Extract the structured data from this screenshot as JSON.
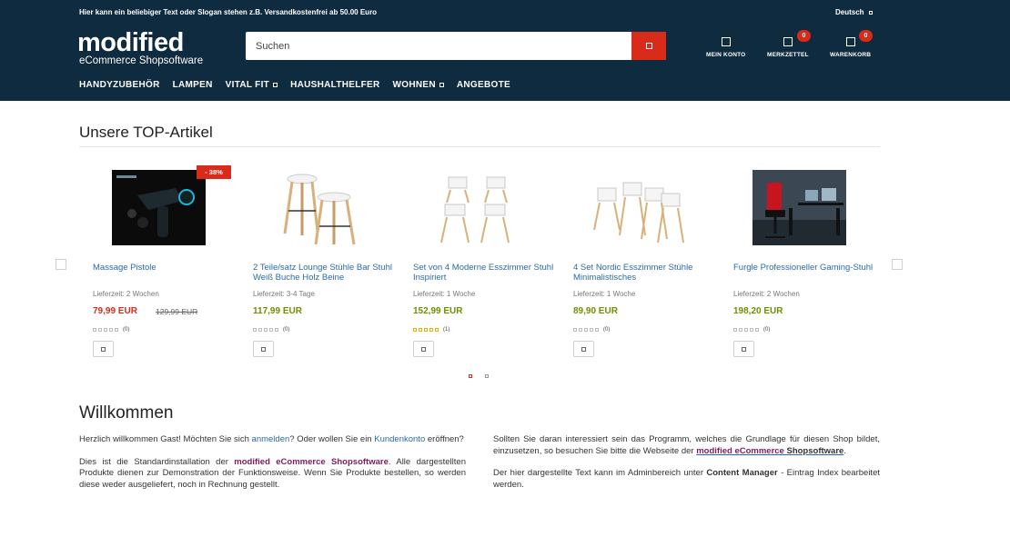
{
  "header": {
    "slogan": "Hier kann ein beliebiger Text oder Slogan stehen z.B. Versandkostenfrei ab 50.00 Euro",
    "language": "Deutsch",
    "logo_word": "modified",
    "logo_sub": "eCommerce Shopsoftware",
    "search_placeholder": "Suchen",
    "account_label": "MEIN KONTO",
    "wishlist_label": "MERKZETTEL",
    "wishlist_count": "0",
    "cart_label": "WARENKORB",
    "cart_count": "0"
  },
  "nav": [
    "HANDYZUBEHÖR",
    "LAMPEN",
    "VITAL FIT",
    "HAUSHALTHELFER",
    "WOHNEN",
    "ANGEBOTE"
  ],
  "top_section": {
    "title": "Unsere TOP-Artikel",
    "products": [
      {
        "name": "Massage Pistole",
        "delivery": "Lieferzeit: 2 Wochen",
        "price": "79,99 EUR",
        "old_price": "129,99 EUR",
        "discount": "- 38%",
        "rating": 0,
        "reviews": "(0)"
      },
      {
        "name": "2 Teile/satz Lounge Stühle Bar Stuhl Weiß Buche Holz Beine",
        "delivery": "Lieferzeit: 3-4 Tage",
        "price": "117,99 EUR",
        "rating": 0,
        "reviews": "(0)"
      },
      {
        "name": "Set von 4 Moderne Esszimmer Stuhl Inspiriert",
        "delivery": "Lieferzeit: 1 Woche",
        "price": "152,99 EUR",
        "rating": 5,
        "reviews": "(1)"
      },
      {
        "name": "4 Set Nordic Esszimmer Stühle Minimalistisches",
        "delivery": "Lieferzeit: 1 Woche",
        "price": "89,90 EUR",
        "rating": 0,
        "reviews": "(0)"
      },
      {
        "name": "Furgle Professioneller Gaming-Stuhl",
        "delivery": "Lieferzeit: 2 Wochen",
        "price": "198,20 EUR",
        "rating": 0,
        "reviews": "(0)"
      }
    ]
  },
  "welcome": {
    "title": "Willkommen",
    "p1_a": "Herzlich willkommen Gast! Möchten Sie sich ",
    "p1_link1": "anmelden",
    "p1_b": "? Oder wollen Sie ein ",
    "p1_link2": "Kundenkonto",
    "p1_c": " eröffnen?",
    "p2_a": "Dies ist die Standardinstallation der ",
    "p2_brand": "modified eCommerce Shopsoftware",
    "p2_b": ". Alle dargestellten Produkte dienen zur Demonstration der Funktionsweise. Wenn Sie Produkte bestellen, so werden diese weder ausgeliefert, noch in Rechnung gestellt.",
    "p3_a": "Sollten Sie daran interessiert sein das Programm, welches die Grundlage für diesen Shop bildet, einzusetzen, so besuchen Sie bitte die Webseite der ",
    "p3_brand": "modified eCommerce",
    "p3_brand2": "Shopsoftware",
    "p3_b": ".",
    "p4_a": "Der hier dargestellte Text kann im Adminbereich unter ",
    "p4_bold": "Content Manager",
    "p4_b": " - Eintrag Index bearbeitet werden."
  },
  "colors": {
    "header_bg": "#0e2b40",
    "accent_red": "#d92b1a",
    "price_green": "#6f8f00",
    "link_blue": "#2a6aa8"
  }
}
